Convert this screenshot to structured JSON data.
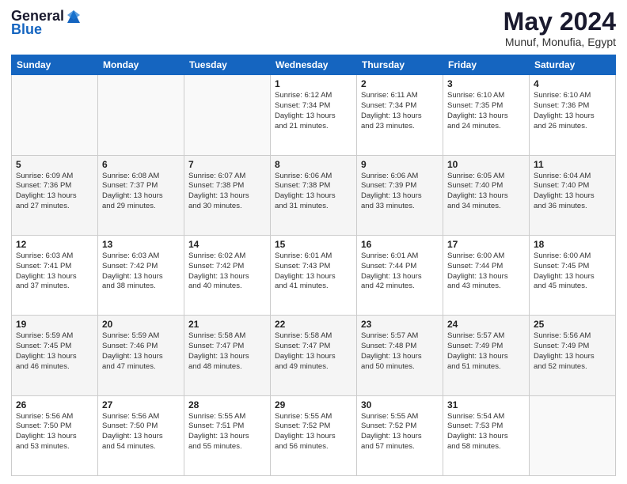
{
  "header": {
    "logo": {
      "general": "General",
      "blue": "Blue"
    },
    "title": "May 2024",
    "location": "Munuf, Monufia, Egypt"
  },
  "calendar": {
    "days_of_week": [
      "Sunday",
      "Monday",
      "Tuesday",
      "Wednesday",
      "Thursday",
      "Friday",
      "Saturday"
    ],
    "weeks": [
      [
        {
          "day": "",
          "content": ""
        },
        {
          "day": "",
          "content": ""
        },
        {
          "day": "",
          "content": ""
        },
        {
          "day": "1",
          "content": "Sunrise: 6:12 AM\nSunset: 7:34 PM\nDaylight: 13 hours\nand 21 minutes."
        },
        {
          "day": "2",
          "content": "Sunrise: 6:11 AM\nSunset: 7:34 PM\nDaylight: 13 hours\nand 23 minutes."
        },
        {
          "day": "3",
          "content": "Sunrise: 6:10 AM\nSunset: 7:35 PM\nDaylight: 13 hours\nand 24 minutes."
        },
        {
          "day": "4",
          "content": "Sunrise: 6:10 AM\nSunset: 7:36 PM\nDaylight: 13 hours\nand 26 minutes."
        }
      ],
      [
        {
          "day": "5",
          "content": "Sunrise: 6:09 AM\nSunset: 7:36 PM\nDaylight: 13 hours\nand 27 minutes."
        },
        {
          "day": "6",
          "content": "Sunrise: 6:08 AM\nSunset: 7:37 PM\nDaylight: 13 hours\nand 29 minutes."
        },
        {
          "day": "7",
          "content": "Sunrise: 6:07 AM\nSunset: 7:38 PM\nDaylight: 13 hours\nand 30 minutes."
        },
        {
          "day": "8",
          "content": "Sunrise: 6:06 AM\nSunset: 7:38 PM\nDaylight: 13 hours\nand 31 minutes."
        },
        {
          "day": "9",
          "content": "Sunrise: 6:06 AM\nSunset: 7:39 PM\nDaylight: 13 hours\nand 33 minutes."
        },
        {
          "day": "10",
          "content": "Sunrise: 6:05 AM\nSunset: 7:40 PM\nDaylight: 13 hours\nand 34 minutes."
        },
        {
          "day": "11",
          "content": "Sunrise: 6:04 AM\nSunset: 7:40 PM\nDaylight: 13 hours\nand 36 minutes."
        }
      ],
      [
        {
          "day": "12",
          "content": "Sunrise: 6:03 AM\nSunset: 7:41 PM\nDaylight: 13 hours\nand 37 minutes."
        },
        {
          "day": "13",
          "content": "Sunrise: 6:03 AM\nSunset: 7:42 PM\nDaylight: 13 hours\nand 38 minutes."
        },
        {
          "day": "14",
          "content": "Sunrise: 6:02 AM\nSunset: 7:42 PM\nDaylight: 13 hours\nand 40 minutes."
        },
        {
          "day": "15",
          "content": "Sunrise: 6:01 AM\nSunset: 7:43 PM\nDaylight: 13 hours\nand 41 minutes."
        },
        {
          "day": "16",
          "content": "Sunrise: 6:01 AM\nSunset: 7:44 PM\nDaylight: 13 hours\nand 42 minutes."
        },
        {
          "day": "17",
          "content": "Sunrise: 6:00 AM\nSunset: 7:44 PM\nDaylight: 13 hours\nand 43 minutes."
        },
        {
          "day": "18",
          "content": "Sunrise: 6:00 AM\nSunset: 7:45 PM\nDaylight: 13 hours\nand 45 minutes."
        }
      ],
      [
        {
          "day": "19",
          "content": "Sunrise: 5:59 AM\nSunset: 7:45 PM\nDaylight: 13 hours\nand 46 minutes."
        },
        {
          "day": "20",
          "content": "Sunrise: 5:59 AM\nSunset: 7:46 PM\nDaylight: 13 hours\nand 47 minutes."
        },
        {
          "day": "21",
          "content": "Sunrise: 5:58 AM\nSunset: 7:47 PM\nDaylight: 13 hours\nand 48 minutes."
        },
        {
          "day": "22",
          "content": "Sunrise: 5:58 AM\nSunset: 7:47 PM\nDaylight: 13 hours\nand 49 minutes."
        },
        {
          "day": "23",
          "content": "Sunrise: 5:57 AM\nSunset: 7:48 PM\nDaylight: 13 hours\nand 50 minutes."
        },
        {
          "day": "24",
          "content": "Sunrise: 5:57 AM\nSunset: 7:49 PM\nDaylight: 13 hours\nand 51 minutes."
        },
        {
          "day": "25",
          "content": "Sunrise: 5:56 AM\nSunset: 7:49 PM\nDaylight: 13 hours\nand 52 minutes."
        }
      ],
      [
        {
          "day": "26",
          "content": "Sunrise: 5:56 AM\nSunset: 7:50 PM\nDaylight: 13 hours\nand 53 minutes."
        },
        {
          "day": "27",
          "content": "Sunrise: 5:56 AM\nSunset: 7:50 PM\nDaylight: 13 hours\nand 54 minutes."
        },
        {
          "day": "28",
          "content": "Sunrise: 5:55 AM\nSunset: 7:51 PM\nDaylight: 13 hours\nand 55 minutes."
        },
        {
          "day": "29",
          "content": "Sunrise: 5:55 AM\nSunset: 7:52 PM\nDaylight: 13 hours\nand 56 minutes."
        },
        {
          "day": "30",
          "content": "Sunrise: 5:55 AM\nSunset: 7:52 PM\nDaylight: 13 hours\nand 57 minutes."
        },
        {
          "day": "31",
          "content": "Sunrise: 5:54 AM\nSunset: 7:53 PM\nDaylight: 13 hours\nand 58 minutes."
        },
        {
          "day": "",
          "content": ""
        }
      ]
    ]
  }
}
